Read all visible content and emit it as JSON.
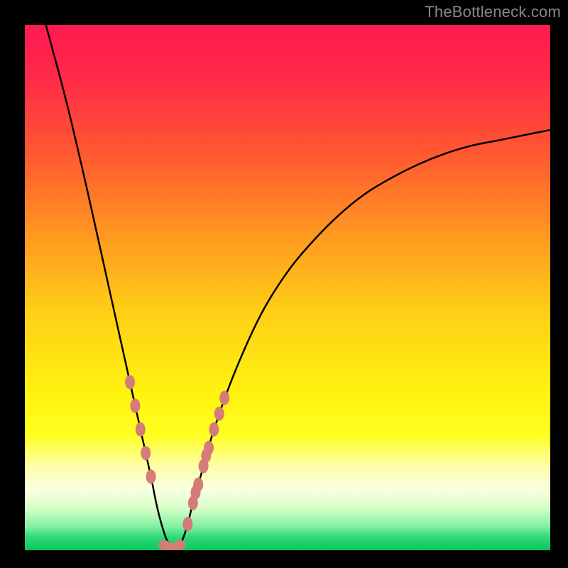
{
  "watermark": "TheBottleneck.com",
  "chart_data": {
    "type": "line",
    "title": "",
    "xlabel": "",
    "ylabel": "",
    "xlim": [
      0,
      100
    ],
    "ylim": [
      0,
      100
    ],
    "curve": {
      "description": "V-shaped bottleneck curve; steep descent from left, minimum near x≈28, asymptotic rise to right",
      "x": [
        4,
        8,
        12,
        16,
        20,
        22,
        24,
        25,
        26,
        27,
        28,
        29,
        30,
        31,
        32,
        34,
        36,
        40,
        45,
        50,
        55,
        60,
        65,
        70,
        75,
        80,
        85,
        90,
        95,
        100
      ],
      "y": [
        100,
        85,
        68,
        50,
        32,
        23,
        14,
        9,
        5,
        2,
        0.5,
        0.5,
        2,
        5,
        9,
        16,
        23,
        34,
        45,
        53,
        59,
        64,
        68,
        71,
        73.5,
        75.5,
        77,
        78,
        79,
        80
      ]
    },
    "markers_left": [
      {
        "x": 20,
        "y": 32
      },
      {
        "x": 21,
        "y": 27.5
      },
      {
        "x": 22,
        "y": 23
      },
      {
        "x": 23,
        "y": 18.5
      },
      {
        "x": 24,
        "y": 14
      }
    ],
    "markers_right": [
      {
        "x": 31,
        "y": 5
      },
      {
        "x": 32,
        "y": 9
      },
      {
        "x": 32.5,
        "y": 11
      },
      {
        "x": 33,
        "y": 12.5
      },
      {
        "x": 34,
        "y": 16
      },
      {
        "x": 34.5,
        "y": 18
      },
      {
        "x": 35,
        "y": 19.5
      },
      {
        "x": 36,
        "y": 23
      },
      {
        "x": 37,
        "y": 26
      },
      {
        "x": 38,
        "y": 29
      }
    ],
    "markers_bottom": [
      {
        "x": 26.5,
        "y": 1
      },
      {
        "x": 27.5,
        "y": 0.5
      },
      {
        "x": 28.5,
        "y": 0.5
      },
      {
        "x": 29.5,
        "y": 1
      }
    ],
    "gradient_stops": [
      {
        "offset": 0.0,
        "color": "#ff1a52"
      },
      {
        "offset": 0.1,
        "color": "#ff2a48"
      },
      {
        "offset": 0.25,
        "color": "#ff5a30"
      },
      {
        "offset": 0.4,
        "color": "#ff9820"
      },
      {
        "offset": 0.55,
        "color": "#ffd016"
      },
      {
        "offset": 0.7,
        "color": "#fff210"
      },
      {
        "offset": 0.78,
        "color": "#ffff20"
      },
      {
        "offset": 0.84,
        "color": "#feffa8"
      },
      {
        "offset": 0.885,
        "color": "#f8ffe0"
      },
      {
        "offset": 0.92,
        "color": "#d8ffc8"
      },
      {
        "offset": 0.955,
        "color": "#80f0a0"
      },
      {
        "offset": 0.975,
        "color": "#30d878"
      },
      {
        "offset": 1.0,
        "color": "#08c85a"
      }
    ],
    "marker_color": "#d77a7a",
    "curve_color": "#000000"
  }
}
